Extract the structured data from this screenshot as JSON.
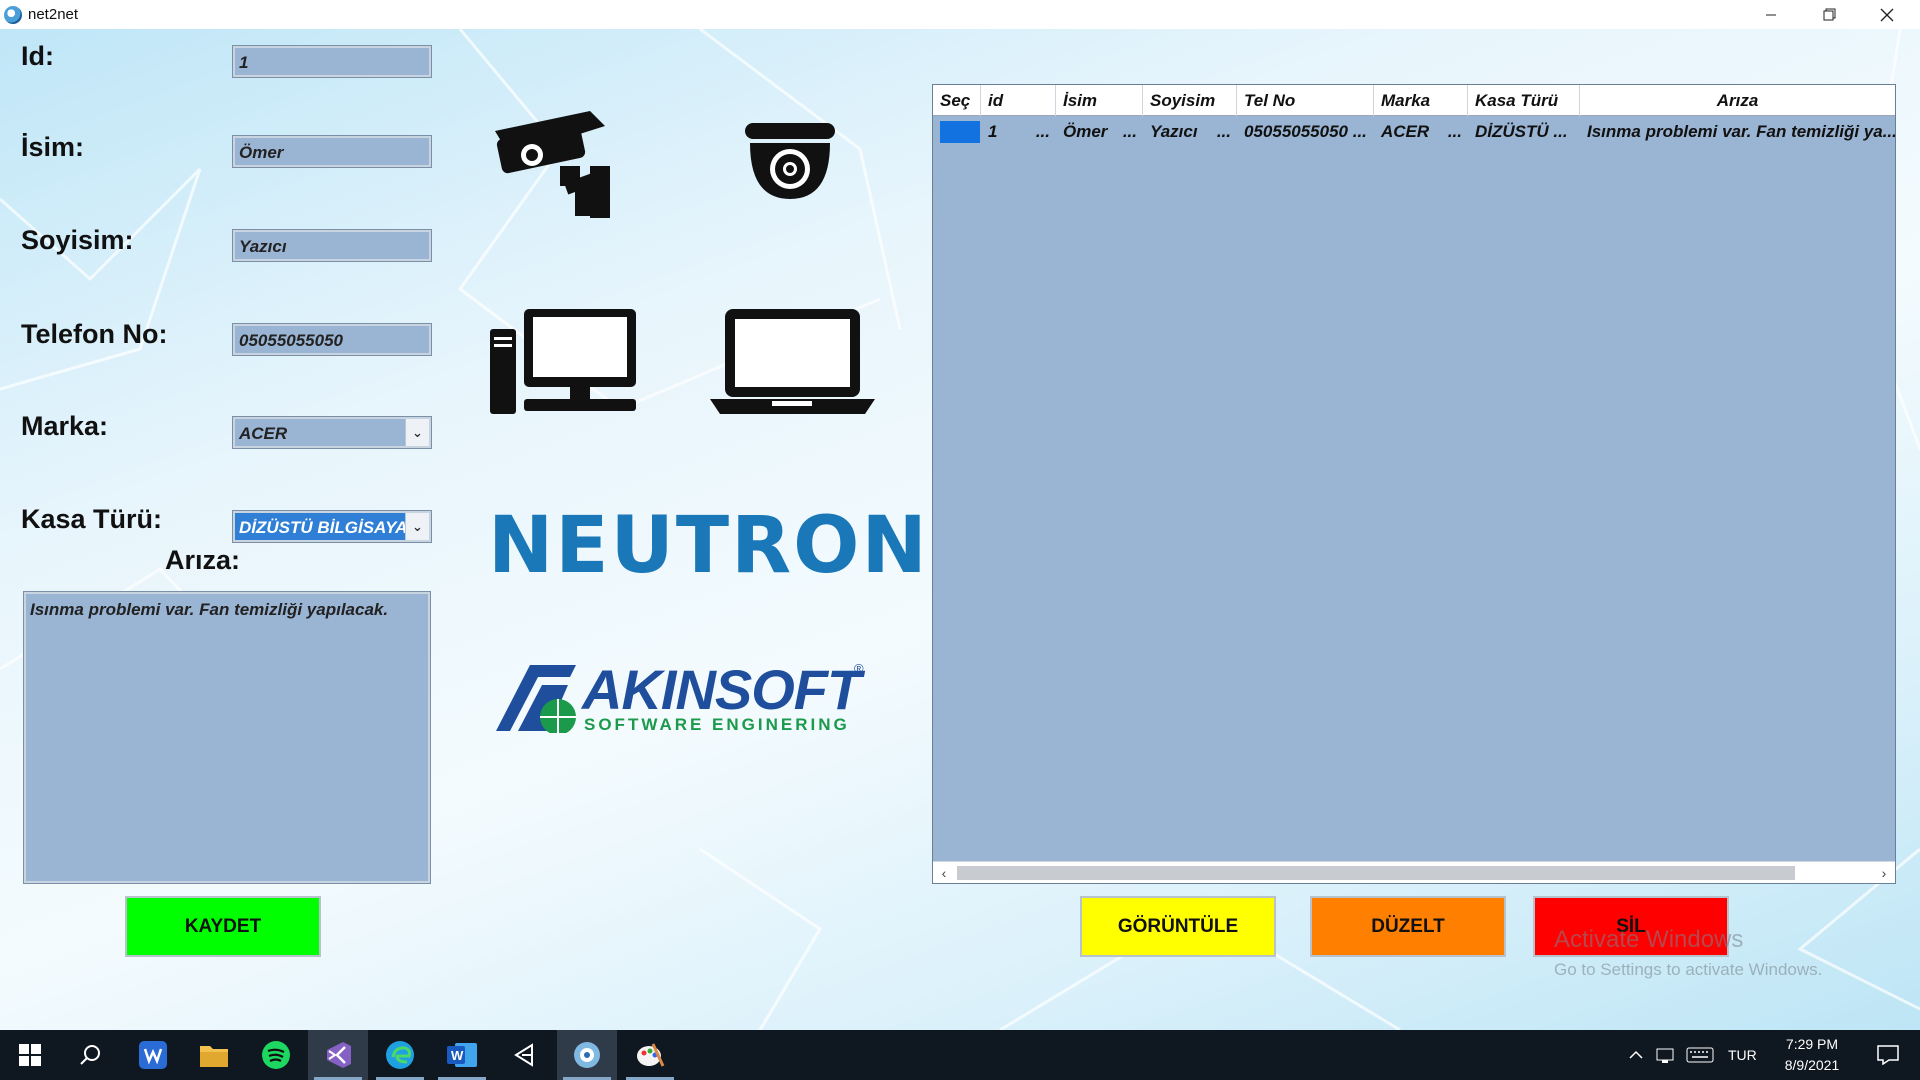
{
  "window": {
    "title": "net2net"
  },
  "form": {
    "id_label": "Id:",
    "id_value": "1",
    "name_label": "İsim:",
    "name_value": "Ömer",
    "surname_label": "Soyisim:",
    "surname_value": "Yazıcı",
    "phone_label": "Telefon No:",
    "phone_value": "05055055050",
    "brand_label": "Marka:",
    "brand_value": "ACER",
    "case_label": "Kasa Türü:",
    "case_value": "DİZÜSTÜ BİLGİSAYAR",
    "fault_label": "Arıza:",
    "fault_value": "Isınma problemi var. Fan temizliği yapılacak.",
    "save_label": "KAYDET"
  },
  "logos": {
    "neutron": "NEUTRON",
    "akinsoft": "AKINSOFT",
    "akinsoft_sub": "SOFTWARE ENGINERING",
    "registered": "®"
  },
  "grid": {
    "columns": [
      "Seç",
      "id",
      "İsim",
      "Soyisim",
      "Tel No",
      "Marka",
      "Kasa Türü",
      "Arıza"
    ],
    "rows": [
      {
        "id": "1",
        "isim": "Ömer",
        "soyisim": "Yazıcı",
        "telno": "05055055050 ...",
        "marka": "ACER",
        "kasa": "DİZÜSTÜ ...",
        "ariza": "Isınma problemi var. Fan temizliği ya..."
      }
    ],
    "ellipsis": "..."
  },
  "buttons": {
    "view": "GÖRÜNTÜLE",
    "edit": "DÜZELT",
    "delete": "SİL"
  },
  "watermark": {
    "line1": "Activate Windows",
    "line2": "Go to Settings to activate Windows."
  },
  "taskbar": {
    "language": "TUR",
    "time": "7:29 PM",
    "date": "8/9/2021"
  },
  "colors": {
    "save": "#00ff00",
    "view": "#ffff00",
    "edit": "#ff8000",
    "delete": "#ff0000",
    "field": "#9ab4d3",
    "neutron": "#1a78b8",
    "akinsoft": "#1f4e9c",
    "akinsoft_green": "#1a9a4a"
  }
}
